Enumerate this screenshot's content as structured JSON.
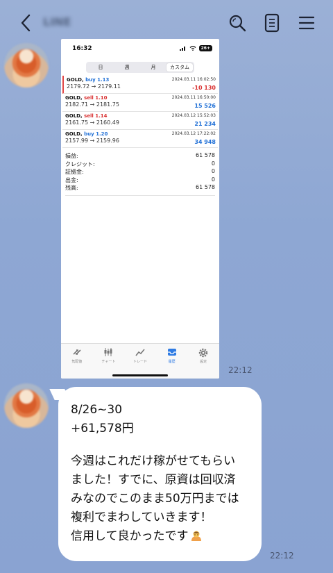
{
  "header": {
    "chat_title": "LINE",
    "back_icon": "chevron-left-icon",
    "search_icon": "search-icon",
    "note_icon": "note-icon",
    "menu_icon": "menu-icon"
  },
  "screenshot": {
    "status_time": "16:32",
    "battery": "26+",
    "segments": [
      {
        "label": "日"
      },
      {
        "label": "週"
      },
      {
        "label": "月"
      },
      {
        "label": "カスタム"
      }
    ],
    "trades": [
      {
        "symbol": "GOLD,",
        "side": "buy",
        "lots": "1.13",
        "date": "2024.03.11 16:02:50",
        "prices": "2179.72 → 2179.11",
        "profit": "-10 130"
      },
      {
        "symbol": "GOLD,",
        "side": "sell",
        "lots": "1.10",
        "date": "2024.03.11 16:50:00",
        "prices": "2182.71 → 2181.75",
        "profit": "15 526"
      },
      {
        "symbol": "GOLD,",
        "side": "sell",
        "lots": "1.14",
        "date": "2024.03.12 15:52:03",
        "prices": "2161.75 → 2160.49",
        "profit": "21 234"
      },
      {
        "symbol": "GOLD,",
        "side": "buy",
        "lots": "1.20",
        "date": "2024.03.12 17:22:02",
        "prices": "2157.99 → 2159.96",
        "profit": "34 948"
      }
    ],
    "summary": [
      {
        "label": "損益:",
        "value": "61 578"
      },
      {
        "label": "クレジット:",
        "value": "0"
      },
      {
        "label": "証拠金:",
        "value": "0"
      },
      {
        "label": "出金:",
        "value": "0"
      },
      {
        "label": "残高:",
        "value": "61 578"
      }
    ],
    "tabs": [
      {
        "label": "気配値",
        "icon": "arrows-icon"
      },
      {
        "label": "チャート",
        "icon": "candles-icon"
      },
      {
        "label": "トレード",
        "icon": "trend-icon"
      },
      {
        "label": "履歴",
        "icon": "inbox-icon"
      },
      {
        "label": "設定",
        "icon": "gear-icon"
      }
    ]
  },
  "messages": {
    "time1": "22:12",
    "time2": "22:12",
    "lines": {
      "l1": "8/26~30",
      "l2": "+61,578円",
      "l3": "今週はこれだけ稼がせてもらい",
      "l4": "ました！すでに、原資は回収済",
      "l5": "みなのでこのまま50万円までは",
      "l6": "複利でまわしていきます！",
      "l7": "信用して良かったです"
    },
    "emoji": "bowing-person-emoji"
  }
}
